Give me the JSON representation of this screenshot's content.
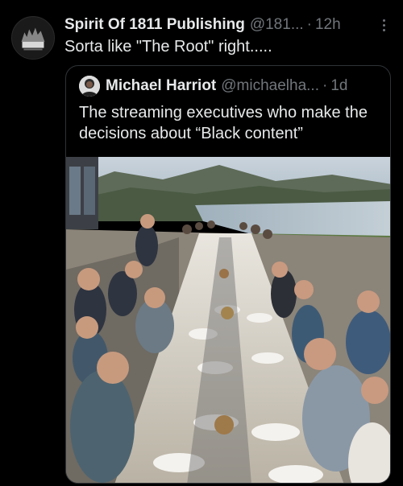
{
  "tweet": {
    "author_name": "Spirit Of 1811 Publishing",
    "author_handle": "@181...",
    "separator": "·",
    "time": "12h",
    "text": "Sorta like \"The Root\" right.....",
    "avatar_logo_text": "1811",
    "avatar_icon": "publisher-logo",
    "more_icon": "more-vertical-icon"
  },
  "quoted_tweet": {
    "author_name": "Michael Harriot",
    "author_handle": "@michaelha...",
    "separator": "·",
    "time": "1d",
    "text": "The streaming executives who make the decisions about “Black content”",
    "media_type": "photo"
  },
  "colors": {
    "background": "#000000",
    "primary_text": "#e7e9ea",
    "secondary_text": "#71767b",
    "border": "#2f3336"
  }
}
